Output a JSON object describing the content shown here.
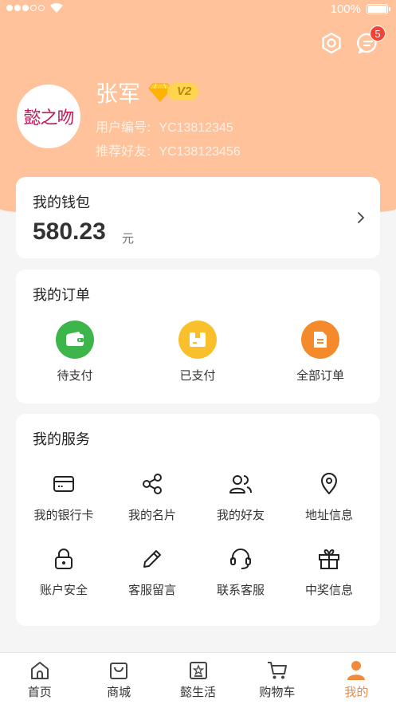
{
  "status_bar": {
    "battery": "100%"
  },
  "header": {
    "message_badge": "5"
  },
  "profile": {
    "avatar_text": "懿之吻",
    "name": "张军",
    "vip_level": "V2",
    "user_id_label": "用户编号:",
    "user_id": "YC13812345",
    "referrer_label": "推荐好友:",
    "referrer_id": "YC138123456"
  },
  "wallet": {
    "title": "我的钱包",
    "amount": "580.23",
    "unit": "元"
  },
  "orders": {
    "title": "我的订单",
    "items": [
      {
        "label": "待支付",
        "color": "#3cb54a",
        "icon": "wallet-icon"
      },
      {
        "label": "已支付",
        "color": "#f9c02c",
        "icon": "box-icon"
      },
      {
        "label": "全部订单",
        "color": "#f58a2c",
        "icon": "document-icon"
      }
    ]
  },
  "services": {
    "title": "我的服务",
    "items": [
      {
        "label": "我的银行卡",
        "icon": "bank-card-icon"
      },
      {
        "label": "我的名片",
        "icon": "share-icon"
      },
      {
        "label": "我的好友",
        "icon": "friends-icon"
      },
      {
        "label": "地址信息",
        "icon": "location-icon"
      },
      {
        "label": "账户安全",
        "icon": "lock-icon"
      },
      {
        "label": "客服留言",
        "icon": "pencil-icon"
      },
      {
        "label": "联系客服",
        "icon": "headset-icon"
      },
      {
        "label": "中奖信息",
        "icon": "gift-icon"
      }
    ]
  },
  "tabbar": {
    "items": [
      {
        "label": "首页",
        "icon": "home-icon"
      },
      {
        "label": "商城",
        "icon": "shopping-bag-icon"
      },
      {
        "label": "懿生活",
        "icon": "life-icon"
      },
      {
        "label": "购物车",
        "icon": "cart-icon"
      },
      {
        "label": "我的",
        "icon": "user-icon",
        "active": true
      }
    ],
    "active_color": "#f08a3c"
  },
  "colors": {
    "header_bg": "#ffc29a",
    "accent": "#f08a3c"
  }
}
